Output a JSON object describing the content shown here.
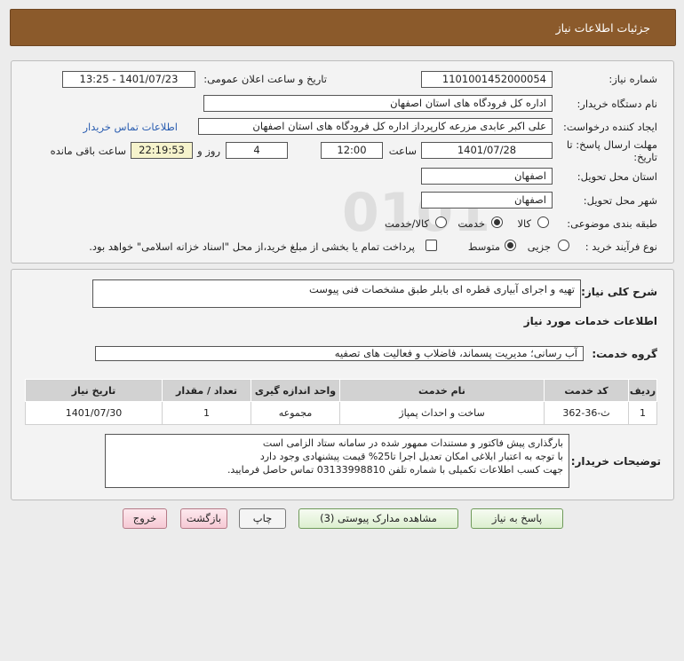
{
  "header": {
    "title": "جزئیات اطلاعات نیاز"
  },
  "info": {
    "need_number_label": "شماره نیاز:",
    "need_number": "1101001452000054",
    "announce_label": "تاریخ و ساعت اعلان عمومی:",
    "announce_value": "1401/07/23 - 13:25",
    "buyer_org_label": "نام دستگاه خریدار:",
    "buyer_org": "اداره کل فرودگاه های استان اصفهان",
    "creator_label": "ایجاد کننده درخواست:",
    "creator": "علی اکبر عابدی مزرعه کارپرداز اداره کل فرودگاه های استان اصفهان",
    "contact_link": "اطلاعات تماس خریدار",
    "deadline_label": "مهلت ارسال پاسخ: تا تاریخ:",
    "deadline_date": "1401/07/28",
    "time_label": "ساعت",
    "deadline_time": "12:00",
    "days_value": "4",
    "days_label": "روز و",
    "remaining_time": "22:19:53",
    "remaining_label": "ساعت باقی مانده",
    "province_label": "استان محل تحویل:",
    "province": "اصفهان",
    "city_label": "شهر محل تحویل:",
    "city": "اصفهان",
    "category_label": "طبقه بندی موضوعی:",
    "category_options": [
      "کالا",
      "خدمت",
      "کالا/خدمت"
    ],
    "category_selected": "خدمت",
    "process_label": "نوع فرآیند خرید :",
    "process_options": [
      "جزیی",
      "متوسط"
    ],
    "process_selected": "متوسط",
    "payment_note": "پرداخت تمام یا بخشی از مبلغ خرید،از محل \"اسناد خزانه اسلامی\" خواهد بود."
  },
  "summary": {
    "label": "شرح کلی نیاز:",
    "text": "تهیه و اجرای آبیاری قطره ای بابلر  طبق مشخصات فنی پیوست"
  },
  "services": {
    "section_title": "اطلاعات خدمات مورد نیاز",
    "group_label": "گروه خدمت:",
    "group_value": "آب رسانی؛ مدیریت پسماند، فاضلاب و فعالیت های تصفیه",
    "columns": [
      "ردیف",
      "کد خدمت",
      "نام خدمت",
      "واحد اندازه گیری",
      "تعداد / مقدار",
      "تاریخ نیاز"
    ],
    "rows": [
      [
        "1",
        "ث-36-362",
        "ساخت و احداث پمپاژ",
        "مجموعه",
        "1",
        "1401/07/30"
      ]
    ]
  },
  "buyer_notes": {
    "label": "توضیحات خریدار:",
    "lines": [
      "بارگذاری پیش فاکتور و مستندات ممهور شده در سامانه ستاد الزامی است",
      "با توجه به اعتبار ابلاغی امکان تعدیل اجرا تا25% قیمت پیشنهادی وجود دارد",
      "جهت کسب اطلاعات تکمیلی با شماره تلفن 03133998810 تماس حاصل فرمایید."
    ]
  },
  "buttons": {
    "reply": "پاسخ به نیاز",
    "attachments": "مشاهده مدارک پیوستی (3)",
    "print": "چاپ",
    "back": "بازگشت",
    "exit": "خروج"
  },
  "colors": {
    "header_bg": "#8b5a2b",
    "link": "#2a5db0",
    "remaining_bg": "#f6f3cc"
  }
}
